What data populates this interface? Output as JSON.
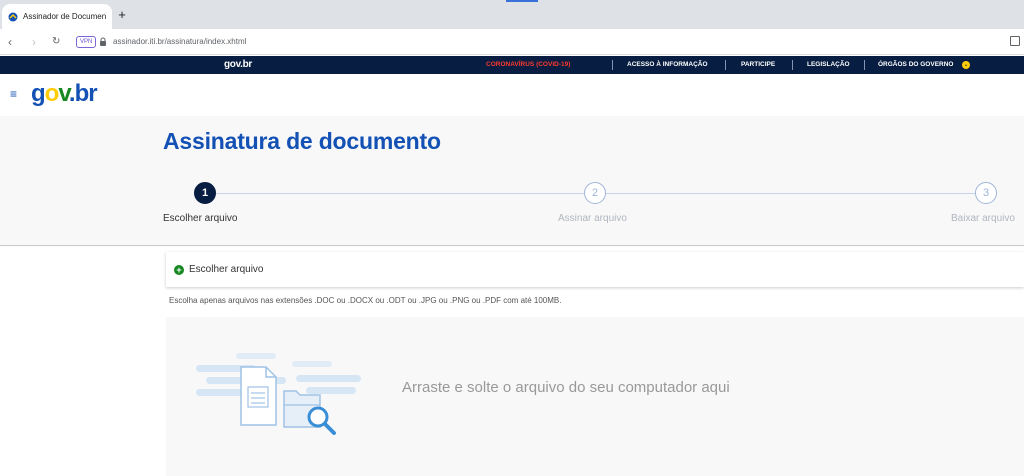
{
  "browser": {
    "tab_title": "Assinador de Documento",
    "new_tab_symbol": "+",
    "url": "assinador.iti.br/assinatura/index.xhtml",
    "vpn_badge": "VPN"
  },
  "topbar": {
    "brand": "gov.br",
    "links": [
      "CORONAVÍRUS (COVID-19)",
      "ACESSO À INFORMAÇÃO",
      "PARTICIPE",
      "LEGISLAÇÃO",
      "ÓRGÃOS DO GOVERNO"
    ],
    "covid_color": "#ff3b30"
  },
  "header": {
    "menu_symbol": "≡",
    "logo": {
      "g": "g",
      "o": "o",
      "v": "v",
      "dot": ".",
      "b": "b",
      "r": "r"
    }
  },
  "page": {
    "title": "Assinatura de documento",
    "steps": [
      {
        "number": "1",
        "label": "Escolher arquivo",
        "active": true
      },
      {
        "number": "2",
        "label": "Assinar arquivo",
        "active": false
      },
      {
        "number": "3",
        "label": "Baixar arquivo",
        "active": false
      }
    ],
    "upload_label": "Escolher arquivo",
    "hint": "Escolha apenas arquivos nas extensões .DOC ou .DOCX ou .ODT ou .JPG ou .PNG ou .PDF com até 100MB.",
    "drop_text": "Arraste e solte o arquivo do seu computador aqui"
  },
  "colors": {
    "primary": "#1351b4",
    "dark": "#071d41",
    "success": "#168821",
    "logo_blue": "#1351b4",
    "logo_yellow": "#ffcd07",
    "logo_green": "#168821"
  }
}
